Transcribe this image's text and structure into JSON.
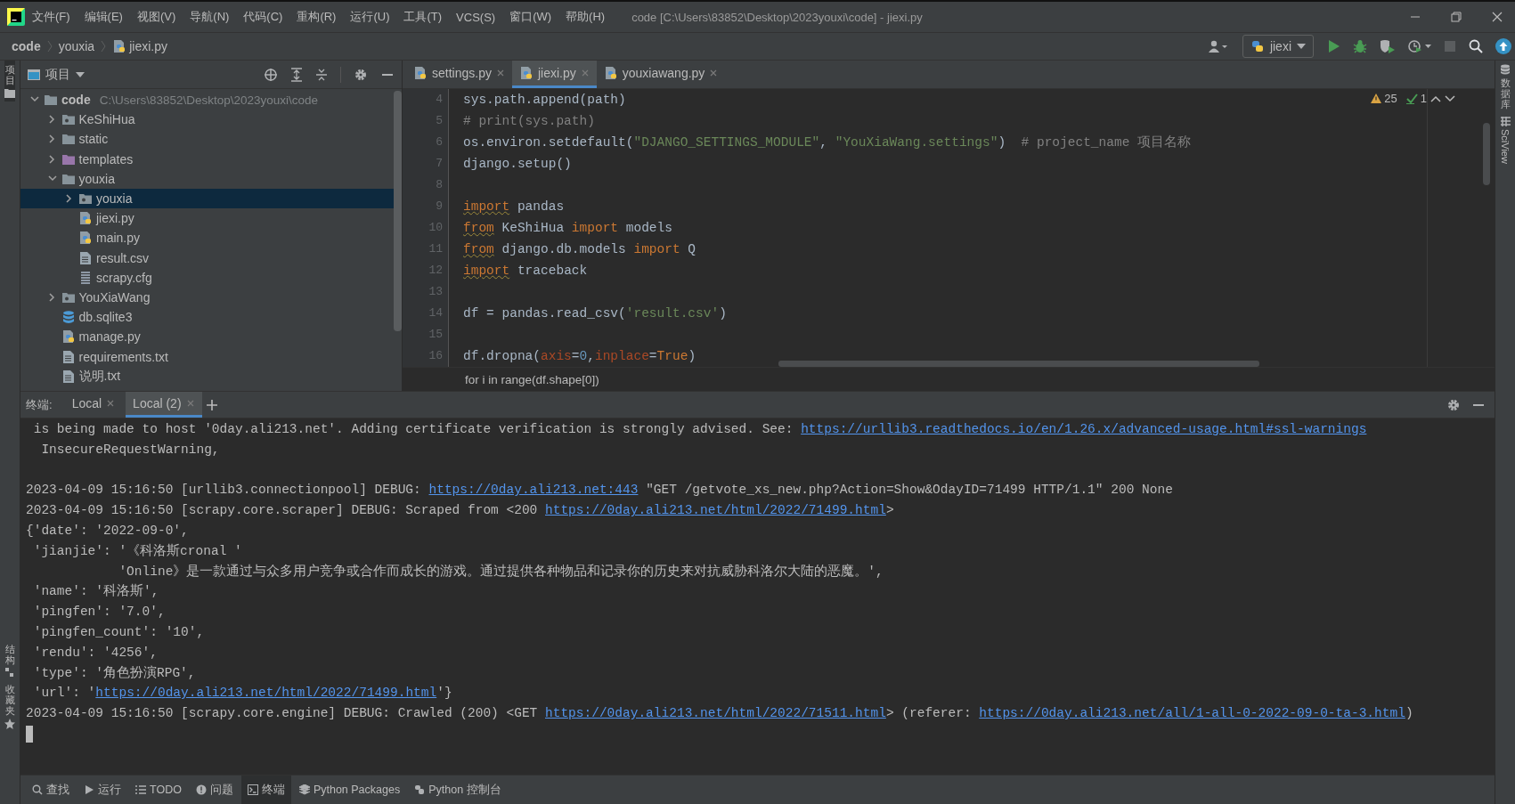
{
  "title_bar": {
    "menu": [
      "文件(F)",
      "编辑(E)",
      "视图(V)",
      "导航(N)",
      "代码(C)",
      "重构(R)",
      "运行(U)",
      "工具(T)",
      "VCS(S)",
      "窗口(W)",
      "帮助(H)"
    ],
    "title": "code [C:\\Users\\83852\\Desktop\\2023youxi\\code] - jiexi.py"
  },
  "breadcrumbs": [
    {
      "label": "code",
      "kind": "project"
    },
    {
      "label": "youxia",
      "kind": "folder"
    },
    {
      "label": "jiexi.py",
      "kind": "python"
    }
  ],
  "run_config": {
    "name": "jiexi"
  },
  "left_strip": {
    "top": [
      "项目"
    ],
    "bottom": [
      "结构",
      "收藏夹"
    ]
  },
  "right_strip": [
    "数据库",
    "SciView"
  ],
  "project_panel": {
    "title": "项目",
    "tree": [
      {
        "label": "code",
        "hint": "C:\\Users\\83852\\Desktop\\2023youxi\\code",
        "kind": "folder",
        "expanded": true,
        "selected": false,
        "children": [
          {
            "label": "KeShiHua",
            "kind": "package",
            "expanded": false,
            "selected": false
          },
          {
            "label": "static",
            "kind": "folder",
            "expanded": false,
            "selected": false
          },
          {
            "label": "templates",
            "kind": "templates",
            "expanded": false,
            "selected": false
          },
          {
            "label": "youxia",
            "kind": "folder",
            "expanded": true,
            "selected": false,
            "children": [
              {
                "label": "youxia",
                "kind": "package",
                "expanded": false,
                "selected": true
              },
              {
                "label": "jiexi.py",
                "kind": "python",
                "selected": false
              },
              {
                "label": "main.py",
                "kind": "python",
                "selected": false
              },
              {
                "label": "result.csv",
                "kind": "text",
                "selected": false
              },
              {
                "label": "scrapy.cfg",
                "kind": "config",
                "selected": false
              }
            ]
          },
          {
            "label": "YouXiaWang",
            "kind": "package",
            "expanded": false,
            "selected": false
          },
          {
            "label": "db.sqlite3",
            "kind": "database",
            "selected": false
          },
          {
            "label": "manage.py",
            "kind": "python",
            "selected": false
          },
          {
            "label": "requirements.txt",
            "kind": "text",
            "selected": false
          },
          {
            "label": "说明.txt",
            "kind": "text",
            "selected": false
          }
        ]
      }
    ]
  },
  "editor": {
    "tabs": [
      {
        "label": "settings.py",
        "selected": false
      },
      {
        "label": "jiexi.py",
        "selected": true
      },
      {
        "label": "youxiawang.py",
        "selected": false
      }
    ],
    "inspections": {
      "warnings": "25",
      "passed": "1"
    },
    "lines": [
      {
        "number": "4",
        "tokens": [
          {
            "text": "sys.path.append(path)",
            "kind": "plain"
          }
        ]
      },
      {
        "number": "5",
        "tokens": [
          {
            "text": "# print(sys.path)",
            "kind": "comment"
          }
        ]
      },
      {
        "number": "6",
        "tokens": [
          {
            "text": "os.environ.setdefault(",
            "kind": "plain"
          },
          {
            "text": "\"DJANGO_SETTINGS_MODULE\"",
            "kind": "string"
          },
          {
            "text": ", ",
            "kind": "plain"
          },
          {
            "text": "\"YouXiaWang.settings\"",
            "kind": "string"
          },
          {
            "text": ")  ",
            "kind": "plain"
          },
          {
            "text": "# project_name 项目名称",
            "kind": "comment"
          }
        ]
      },
      {
        "number": "7",
        "tokens": [
          {
            "text": "django.setup()",
            "kind": "plain"
          }
        ]
      },
      {
        "number": "8"
      },
      {
        "number": "9",
        "tokens": [
          {
            "text": "import",
            "kind": "keyword",
            "squiggle": true
          },
          {
            "text": " pandas",
            "kind": "plain"
          }
        ]
      },
      {
        "number": "10",
        "tokens": [
          {
            "text": "from",
            "kind": "keyword",
            "squiggle": true
          },
          {
            "text": " KeShiHua ",
            "kind": "plain"
          },
          {
            "text": "import",
            "kind": "keyword"
          },
          {
            "text": " models",
            "kind": "plain"
          }
        ]
      },
      {
        "number": "11",
        "tokens": [
          {
            "text": "from",
            "kind": "keyword",
            "squiggle": true
          },
          {
            "text": " django.db.models ",
            "kind": "plain"
          },
          {
            "text": "import",
            "kind": "keyword"
          },
          {
            "text": " Q",
            "kind": "plain"
          }
        ]
      },
      {
        "number": "12",
        "tokens": [
          {
            "text": "import",
            "kind": "keyword",
            "squiggle": true
          },
          {
            "text": " traceback",
            "kind": "plain"
          }
        ]
      },
      {
        "number": "13"
      },
      {
        "number": "14",
        "tokens": [
          {
            "text": "df = pandas.read_csv(",
            "kind": "plain"
          },
          {
            "text": "'result.csv'",
            "kind": "string"
          },
          {
            "text": ")",
            "kind": "plain"
          }
        ]
      },
      {
        "number": "15"
      },
      {
        "number": "16",
        "tokens": [
          {
            "text": "df.dropna(",
            "kind": "plain"
          },
          {
            "text": "axis",
            "kind": "param"
          },
          {
            "text": "=",
            "kind": "plain"
          },
          {
            "text": "0",
            "kind": "number"
          },
          {
            "text": ",",
            "kind": "plain"
          },
          {
            "text": "inplace",
            "kind": "param"
          },
          {
            "text": "=",
            "kind": "plain"
          },
          {
            "text": "True",
            "kind": "keyword"
          },
          {
            "text": ")",
            "kind": "plain"
          }
        ]
      }
    ],
    "breadcrumb": "for i in range(df.shape[0])"
  },
  "terminal": {
    "label": "终端:",
    "tabs": [
      {
        "label": "Local",
        "selected": false
      },
      {
        "label": "Local (2)",
        "selected": true
      }
    ],
    "lines": [
      {
        "segments": [
          {
            "text": " is being made to host '0day.ali213.net'. Adding certificate verification is strongly advised. See: ",
            "kind": "plain"
          },
          {
            "text": "https://urllib3.readthedocs.io/en/1.26.x/advanced-usage.html#ssl-warnings",
            "kind": "link"
          }
        ]
      },
      {
        "segments": [
          {
            "text": "  InsecureRequestWarning,",
            "kind": "plain"
          }
        ]
      },
      {
        "blank_before": true,
        "segments": [
          {
            "text": "2023-04-09 15:16:50 [urllib3.connectionpool] DEBUG: ",
            "kind": "plain"
          },
          {
            "text": "https://0day.ali213.net:443",
            "kind": "link"
          },
          {
            "text": " \"GET /getvote_xs_new.php?Action=Show&OdayID=71499 HTTP/1.1\" 200 None",
            "kind": "plain"
          }
        ]
      },
      {
        "segments": [
          {
            "text": "2023-04-09 15:16:50 [scrapy.core.scraper] DEBUG: Scraped from <200 ",
            "kind": "plain"
          },
          {
            "text": "https://0day.ali213.net/html/2022/71499.html",
            "kind": "link"
          },
          {
            "text": ">",
            "kind": "plain"
          }
        ]
      },
      {
        "segments": [
          {
            "text": "{'date': '2022-09-0',",
            "kind": "plain"
          }
        ]
      },
      {
        "segments": [
          {
            "text": " 'jianjie': '《科洛斯cronal '",
            "kind": "plain"
          }
        ]
      },
      {
        "segments": [
          {
            "text": "            'Online》是一款通过与众多用户竞争或合作而成长的游戏。通过提供各种物品和记录你的历史来对抗威胁科洛尔大陆的恶魔。',",
            "kind": "plain"
          }
        ]
      },
      {
        "segments": [
          {
            "text": " 'name': '科洛斯',",
            "kind": "plain"
          }
        ]
      },
      {
        "segments": [
          {
            "text": " 'pingfen': '7.0',",
            "kind": "plain"
          }
        ]
      },
      {
        "segments": [
          {
            "text": " 'pingfen_count': '10',",
            "kind": "plain"
          }
        ]
      },
      {
        "segments": [
          {
            "text": " 'rendu': '4256',",
            "kind": "plain"
          }
        ]
      },
      {
        "segments": [
          {
            "text": " 'type': '角色扮演RPG',",
            "kind": "plain"
          }
        ]
      },
      {
        "segments": [
          {
            "text": " 'url': '",
            "kind": "plain"
          },
          {
            "text": "https://0day.ali213.net/html/2022/71499.html",
            "kind": "link"
          },
          {
            "text": "'}",
            "kind": "plain"
          }
        ]
      },
      {
        "segments": [
          {
            "text": "2023-04-09 15:16:50 [scrapy.core.engine] DEBUG: Crawled (200) <GET ",
            "kind": "plain"
          },
          {
            "text": "https://0day.ali213.net/html/2022/71511.html",
            "kind": "link"
          },
          {
            "text": "> (referer: ",
            "kind": "plain"
          },
          {
            "text": "https://0day.ali213.net/all/1-all-0-2022-09-0-ta-3.html",
            "kind": "link"
          },
          {
            "text": ")",
            "kind": "plain"
          }
        ]
      }
    ]
  },
  "tool_bar": [
    {
      "label": "查找",
      "kind": "search",
      "selected": false
    },
    {
      "label": "运行",
      "kind": "run",
      "selected": false
    },
    {
      "label": "TODO",
      "kind": "todo",
      "selected": false
    },
    {
      "label": "问题",
      "kind": "problems",
      "selected": false
    },
    {
      "label": "终端",
      "kind": "terminal",
      "selected": true
    },
    {
      "label": "Python Packages",
      "kind": "packages",
      "selected": false
    },
    {
      "label": "Python 控制台",
      "kind": "console",
      "selected": false
    }
  ]
}
